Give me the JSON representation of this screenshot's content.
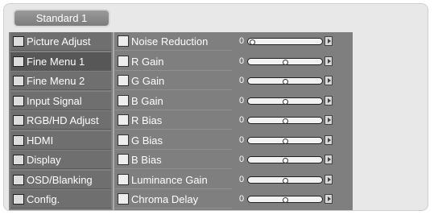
{
  "tab": {
    "label": "Standard 1"
  },
  "left_menu": [
    {
      "label": "Picture Adjust",
      "icon": "grid-icon"
    },
    {
      "label": "Fine Menu 1",
      "icon": "tv-icon",
      "selected": true
    },
    {
      "label": "Fine Menu 2",
      "icon": "tv-icon"
    },
    {
      "label": "Input Signal",
      "icon": "signal-icon"
    },
    {
      "label": "RGB/HD Adjust",
      "icon": "rgb-icon"
    },
    {
      "label": "HDMI",
      "icon": "hdmi-icon"
    },
    {
      "label": "Display",
      "icon": "display-icon"
    },
    {
      "label": "OSD/Blanking",
      "icon": "osd-icon"
    },
    {
      "label": "Config.",
      "icon": "config-icon"
    }
  ],
  "right_menu": [
    {
      "label": "Noise Reduction",
      "icon": "noise-icon",
      "value": "0",
      "level": 0.0
    },
    {
      "label": "R Gain",
      "icon": "gain-icon",
      "value": "0",
      "level": 0.5
    },
    {
      "label": "G Gain",
      "icon": "gain-icon",
      "value": "0",
      "level": 0.5
    },
    {
      "label": "B Gain",
      "icon": "gain-icon",
      "value": "0",
      "level": 0.5
    },
    {
      "label": "R Bias",
      "icon": "bias-icon",
      "value": "0",
      "level": 0.5
    },
    {
      "label": "G Bias",
      "icon": "bias-icon",
      "value": "0",
      "level": 0.5
    },
    {
      "label": "B Bias",
      "icon": "bias-icon",
      "value": "0",
      "level": 0.5
    },
    {
      "label": "Luminance Gain",
      "icon": "luminance-icon",
      "value": "0",
      "level": 0.5
    },
    {
      "label": "Chroma Delay",
      "icon": "chroma-icon",
      "value": "0",
      "level": 0.5
    }
  ]
}
